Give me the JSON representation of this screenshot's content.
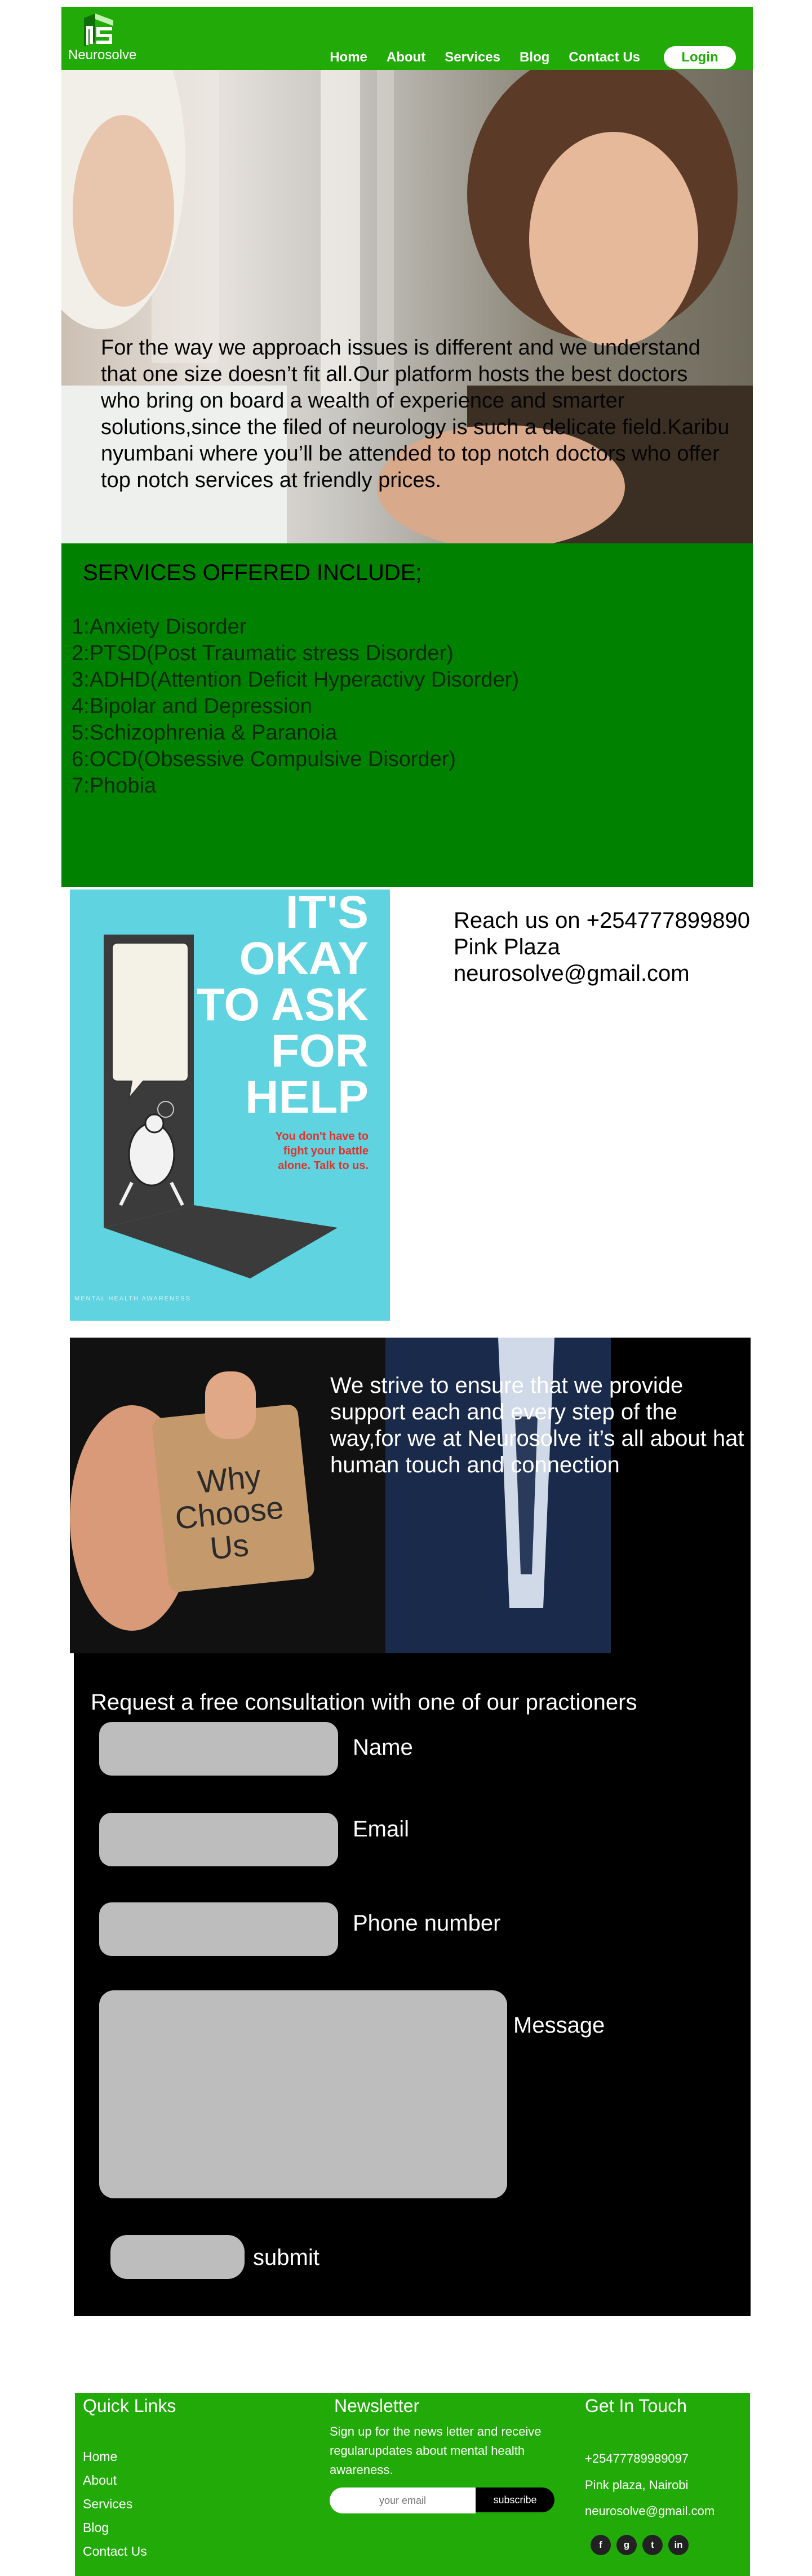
{
  "header": {
    "brand": "Neurosolve",
    "nav": [
      "Home",
      "About",
      "Services",
      "Blog",
      "Contact Us"
    ],
    "login": "Login"
  },
  "hero": {
    "text": "For the way we approach issues is different and we understand that one size doesn’t fit all.Our platform hosts the best doctors who bring on board a wealth of experience and smarter solutions,since the filed of neurology is such a delicate field.Karibu nyumbani where you’ll be attended to top notch doctors who offer top notch services at friendly prices."
  },
  "services": {
    "title": "SERVICES OFFERED INCLUDE;",
    "items": [
      "1:Anxiety Disorder",
      "2:PTSD(Post Traumatic stress Disorder)",
      "3:ADHD(Attention Deficit  Hyperactivy Disorder)",
      "4:Bipolar and Depression",
      "5:Schizophrenia  &  Paranoia",
      "6:OCD(Obsessive Compulsive Disorder)",
      "7:Phobia"
    ]
  },
  "poster": {
    "headline": [
      "IT'S",
      "OKAY",
      "TO ASK",
      "FOR",
      "HELP"
    ],
    "sub": [
      "You don't have to",
      "fight your battle",
      "alone. Talk to us."
    ],
    "footer": "MENTAL HEALTH AWARENESS"
  },
  "contact": {
    "phone": "Reach us on +254777899890",
    "location": "Pink Plaza",
    "email": "neurosolve@gmail.com"
  },
  "why": {
    "image_text": [
      "Why",
      "Choose",
      "Us"
    ],
    "text": "We strive to ensure that we provide support each and every step of the way,for we at Neurosolve it’s all about hat human touch and connection"
  },
  "form": {
    "title": "Request a free consultation with one of our practioners",
    "name_label": "Name",
    "email_label": "Email",
    "phone_label": "Phone number",
    "message_label": "Message",
    "submit_label": "submit"
  },
  "footer": {
    "quick_links_title": "Quick Links",
    "quick_links": [
      "Home",
      "About",
      "Services",
      "Blog",
      "Contact Us"
    ],
    "newsletter_title": "Newsletter",
    "newsletter_text": "Sign up for the news letter and receive regularupdates about mental health awareness.",
    "email_placeholder": "your email",
    "subscribe": "subscribe",
    "touch_title": "Get In Touch",
    "phone": "+25477789989097",
    "address": "Pink plaza, Nairobi",
    "email": "neurosolve@gmail.com",
    "social": [
      "f",
      "g",
      "t",
      "in"
    ]
  },
  "colors": {
    "brand_green": "#22aa08",
    "services_green": "#008200",
    "poster_cyan": "#5fd3df",
    "field_grey": "#bdbdbd"
  }
}
